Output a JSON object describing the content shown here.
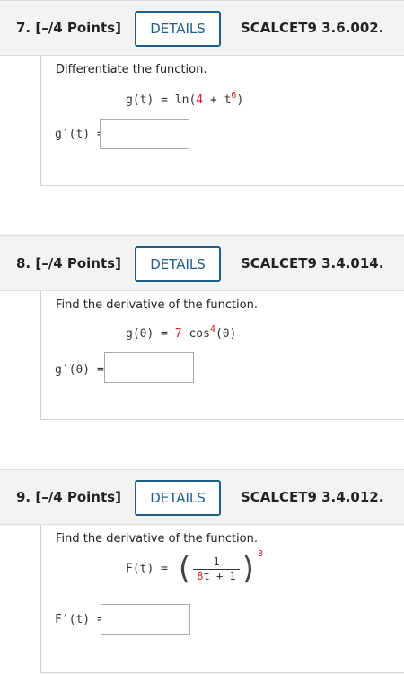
{
  "questions": [
    {
      "number_label": "7.  [–/4 Points]",
      "details_label": "DETAILS",
      "code": "SCALCET9 3.6.002.",
      "prompt": "Differentiate the function.",
      "function": {
        "lhs": "g(t) = ln(",
        "c1": "4",
        "plus": " + t",
        "exp": "6",
        "close": ")"
      },
      "answer_label": "g′(t) =",
      "answer_value": ""
    },
    {
      "number_label": "8.  [–/4 Points]",
      "details_label": "DETAILS",
      "code": "SCALCET9 3.4.014.",
      "prompt": "Find the derivative of the function.",
      "function": {
        "lhs": "g(θ) = ",
        "coef": "7",
        "cos": " cos",
        "exp": "4",
        "arg": "(θ)"
      },
      "answer_label": "g′(θ) =",
      "answer_value": ""
    },
    {
      "number_label": "9.  [–/4 Points]",
      "details_label": "DETAILS",
      "code": "SCALCET9 3.4.012.",
      "prompt": "Find the derivative of the function.",
      "function": {
        "lhs": "F(t) = ",
        "num": "1",
        "den_coef": "8",
        "den_rest": "t + 1",
        "exp": "3"
      },
      "answer_label": "F′(t) =",
      "answer_value": ""
    }
  ]
}
